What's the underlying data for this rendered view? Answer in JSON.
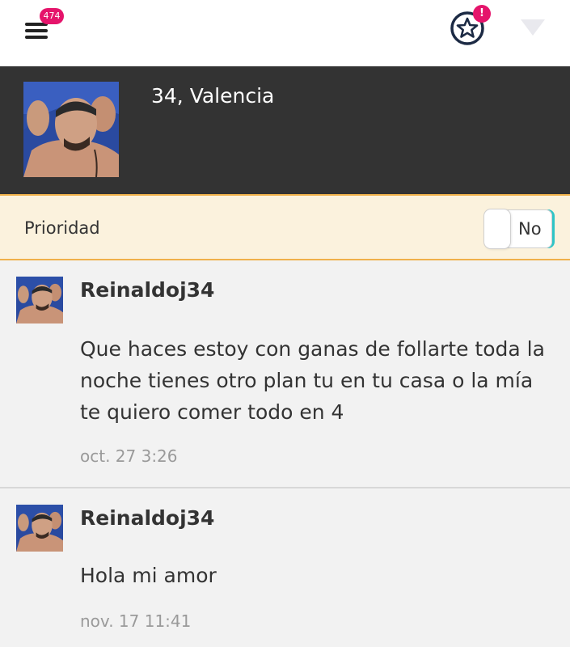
{
  "topbar": {
    "menu_icon": "hamburger-menu-icon",
    "menu_badge": "474",
    "favorites_icon": "star-circle-icon",
    "favorites_badge": "!",
    "dropdown_icon": "triangle-down-icon"
  },
  "profile": {
    "info": "34, Valencia",
    "photo_icon": "profile-photo"
  },
  "priority": {
    "label": "Prioridad",
    "toggle_value": "No"
  },
  "messages": [
    {
      "author": "Reinaldoj34",
      "text": "Que haces estoy con ganas de follarte toda la noche tienes otro plan tu en tu casa o la mía te quiero comer todo en 4",
      "time": "oct. 27 3:26"
    },
    {
      "author": "Reinaldoj34",
      "text": "Hola mi amor",
      "time": "nov. 17 11:41"
    }
  ],
  "colors": {
    "badge": "#e5146b",
    "header_bg": "#333333",
    "priority_bg": "#fbf2dd",
    "priority_border": "#f0b14a",
    "toggle_accent": "#2ec4c6",
    "timestamp": "#9a9a9a"
  }
}
